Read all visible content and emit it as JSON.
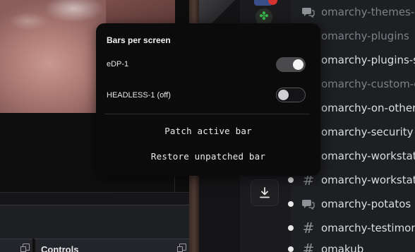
{
  "dock": {
    "controls_title": "Controls"
  },
  "popup": {
    "title": "Bars per screen",
    "screens": [
      {
        "label": "eDP-1",
        "enabled": true
      },
      {
        "label": "HEADLESS-1  (off)",
        "enabled": false
      }
    ],
    "actions": {
      "patch": "Patch active bar",
      "restore": "Restore unpatched bar"
    }
  },
  "channels": [
    {
      "name": "omarchy-themes-s",
      "icon": "forum-icon",
      "muted": true
    },
    {
      "name": "omarchy-plugins",
      "icon": "none",
      "muted": true
    },
    {
      "name": "omarchy-plugins-sh",
      "icon": "none",
      "muted": false
    },
    {
      "name": "omarchy-custom-co",
      "icon": "none",
      "muted": true
    },
    {
      "name": "omarchy-on-other",
      "icon": "none",
      "muted": false
    },
    {
      "name": "omarchy-security",
      "icon": "none",
      "muted": false
    },
    {
      "name": "omarchy-workstatio",
      "icon": "none",
      "muted": false
    },
    {
      "name": "omarchy-workstatio",
      "icon": "hash-icon",
      "muted": false
    },
    {
      "name": "omarchy-potatos",
      "icon": "forum-icon",
      "muted": false
    },
    {
      "name": "omarchy-testimonia",
      "icon": "hash-icon",
      "muted": false
    },
    {
      "name": "omakub",
      "icon": "hash-icon",
      "muted": false
    }
  ],
  "colors": {
    "popup_bg": "#0b0b0c",
    "toggle_on": "#4a4a4d",
    "channel_text": "#dbdee1",
    "channel_muted": "#7d8187",
    "badge": "#d6322f"
  }
}
